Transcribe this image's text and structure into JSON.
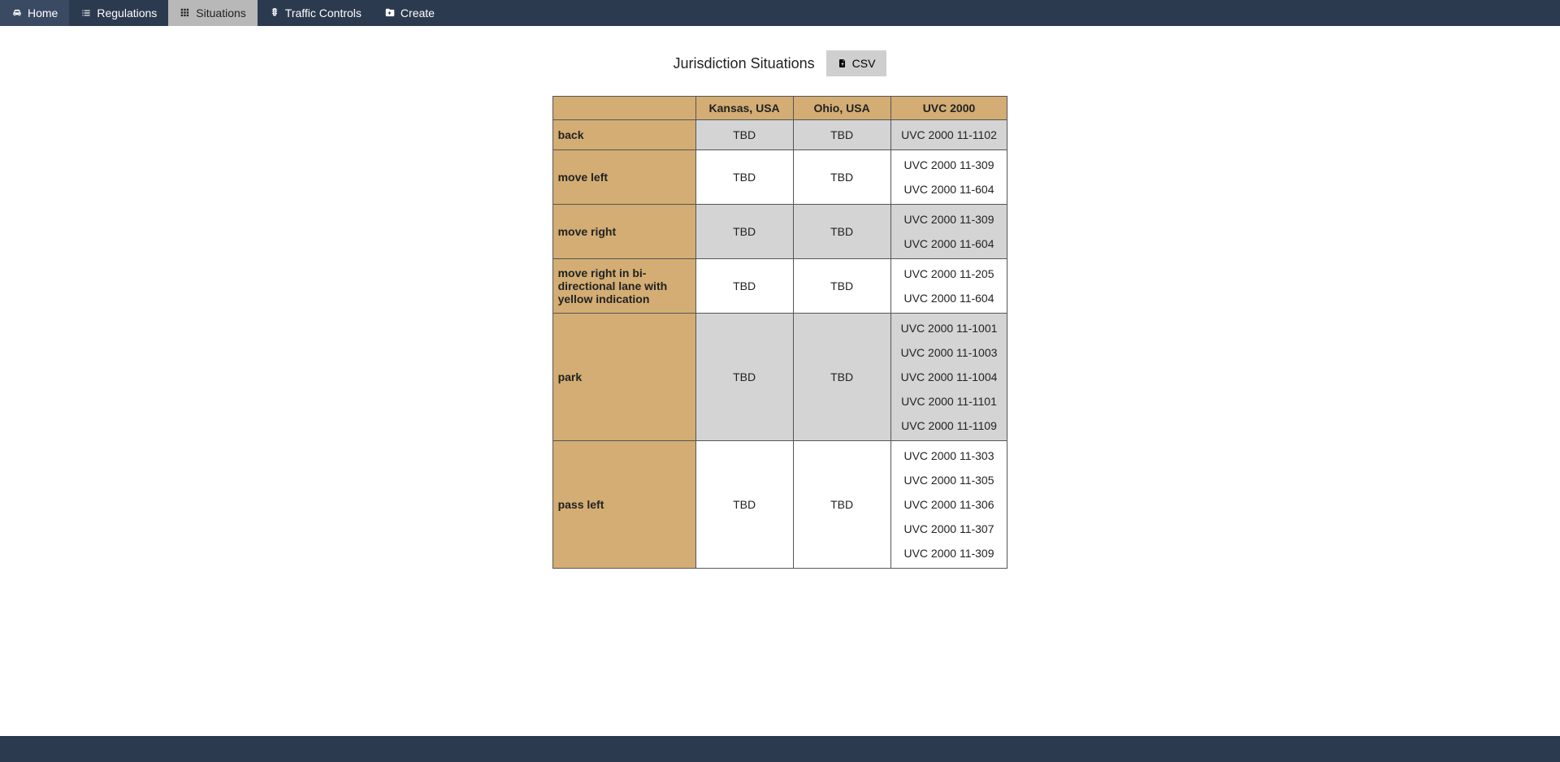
{
  "nav": {
    "items": [
      {
        "label": "Home",
        "icon": "car-icon",
        "active": false
      },
      {
        "label": "Regulations",
        "icon": "list-icon",
        "active": false
      },
      {
        "label": "Situations",
        "icon": "grid-icon",
        "active": true
      },
      {
        "label": "Traffic Controls",
        "icon": "traffic-icon",
        "active": false
      },
      {
        "label": "Create",
        "icon": "folder-icon",
        "active": false
      }
    ]
  },
  "header": {
    "title": "Jurisdiction Situations",
    "csv_label": "CSV"
  },
  "table": {
    "columns": [
      "Kansas, USA",
      "Ohio, USA",
      "UVC 2000"
    ],
    "rows": [
      {
        "label": "back",
        "cells": [
          "TBD",
          "TBD",
          [
            "UVC 2000 11-1102"
          ]
        ]
      },
      {
        "label": "move left",
        "cells": [
          "TBD",
          "TBD",
          [
            "UVC 2000 11-309",
            "UVC 2000 11-604"
          ]
        ]
      },
      {
        "label": "move right",
        "cells": [
          "TBD",
          "TBD",
          [
            "UVC 2000 11-309",
            "UVC 2000 11-604"
          ]
        ]
      },
      {
        "label": "move right in bi-directional lane with yellow indication",
        "cells": [
          "TBD",
          "TBD",
          [
            "UVC 2000 11-205",
            "UVC 2000 11-604"
          ]
        ]
      },
      {
        "label": "park",
        "cells": [
          "TBD",
          "TBD",
          [
            "UVC 2000 11-1001",
            "UVC 2000 11-1003",
            "UVC 2000 11-1004",
            "UVC 2000 11-1101",
            "UVC 2000 11-1109"
          ]
        ]
      },
      {
        "label": "pass left",
        "cells": [
          "TBD",
          "TBD",
          [
            "UVC 2000 11-303",
            "UVC 2000 11-305",
            "UVC 2000 11-306",
            "UVC 2000 11-307",
            "UVC 2000 11-309"
          ]
        ]
      }
    ]
  }
}
